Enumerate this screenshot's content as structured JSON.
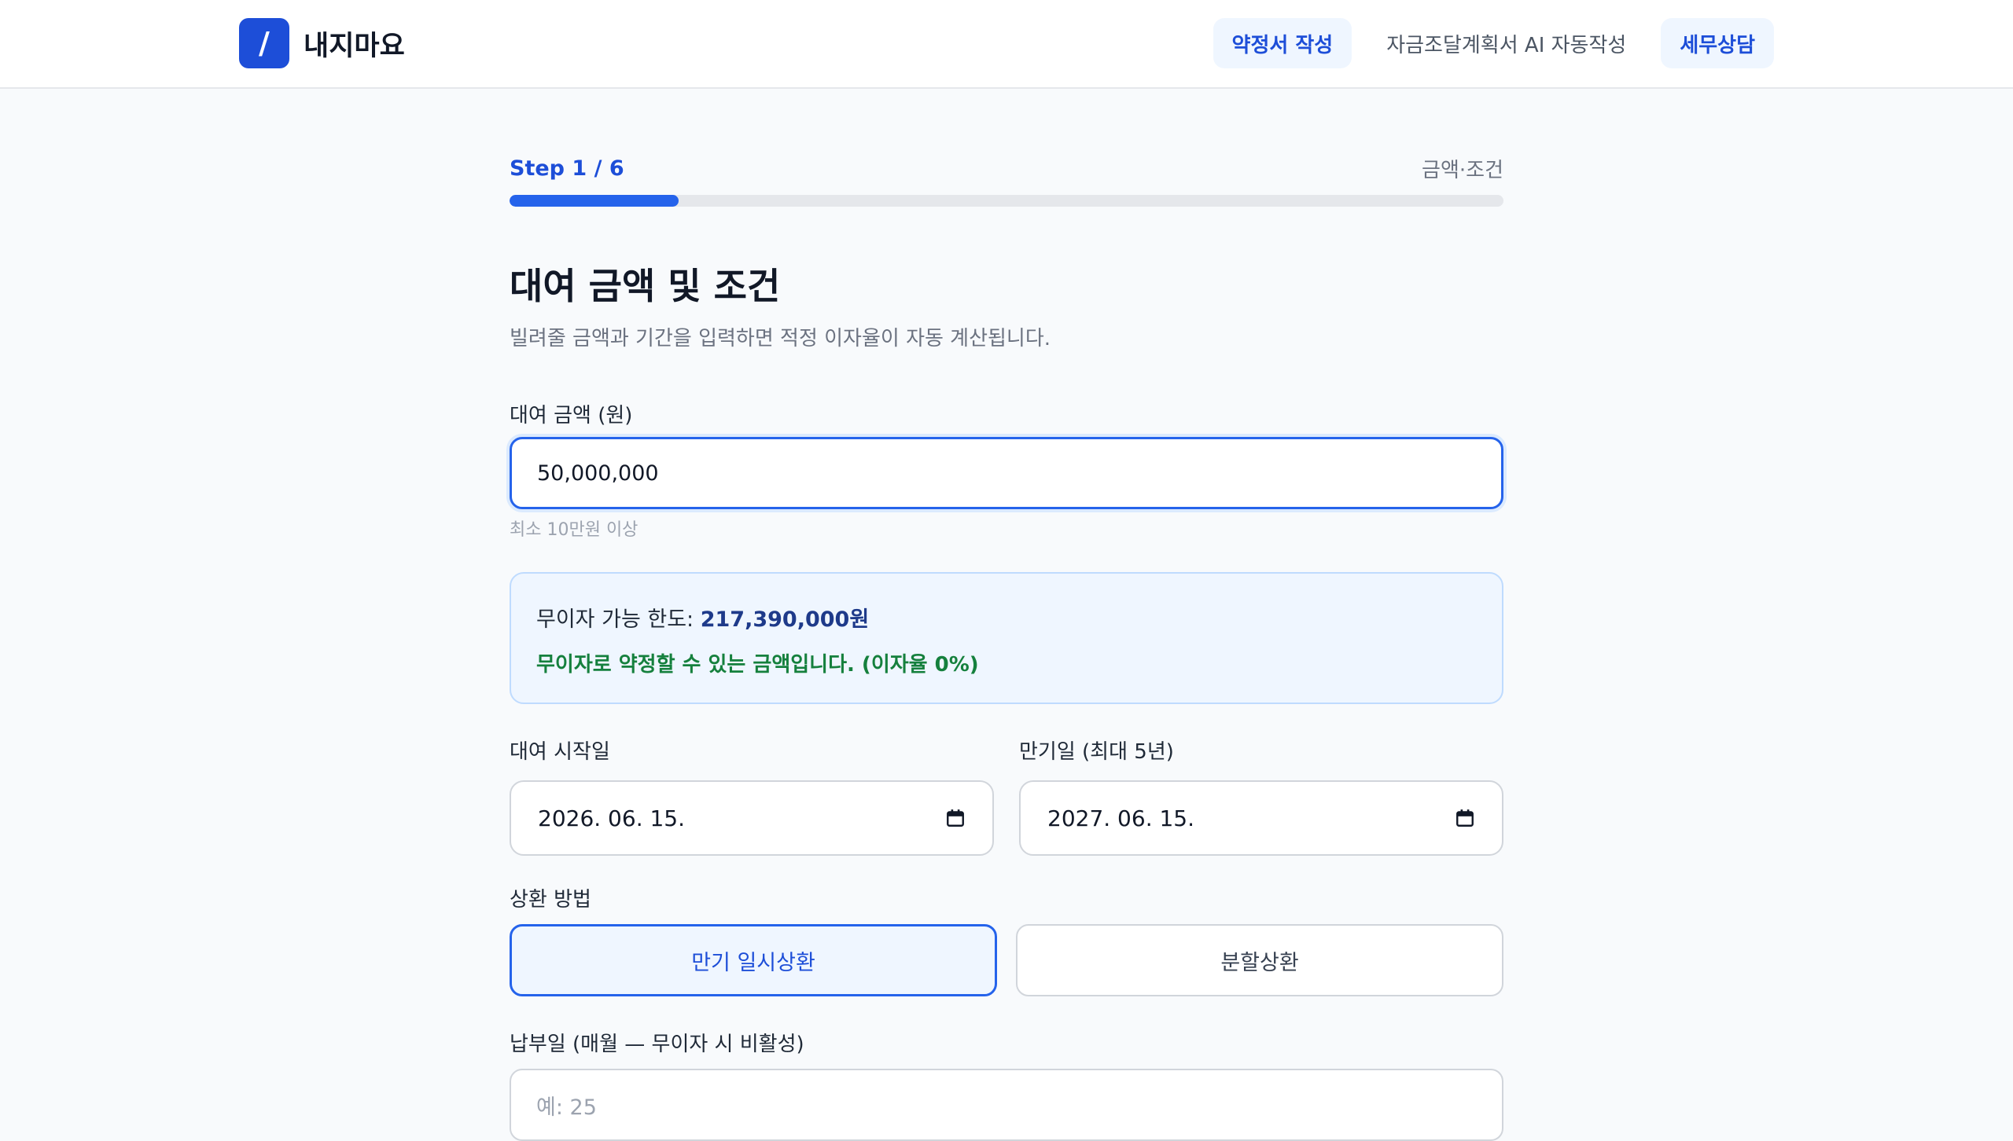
{
  "header": {
    "logo_glyph": "/",
    "brand_name": "내지마요",
    "nav": [
      {
        "label": "약정서 작성",
        "active": true
      },
      {
        "label": "자금조달계획서 AI 자동작성",
        "active": false
      },
      {
        "label": "세무상담",
        "active": true
      }
    ]
  },
  "progress": {
    "step_label": "Step 1 / 6",
    "step_name": "금액·조건",
    "current": 1,
    "total": 6,
    "fill_fraction": 0.17
  },
  "page": {
    "title": "대여 금액 및 조건",
    "description": "빌려줄 금액과 기간을 입력하면 적정 이자율이 자동 계산됩니다."
  },
  "amount": {
    "label": "대여 금액 (원)",
    "value": "50,000,000",
    "hint": "최소 10만원 이상"
  },
  "info": {
    "limit_prefix": "무이자 가능 한도: ",
    "limit_value": "217,390,000원",
    "status": "무이자로 약정할 수 있는 금액입니다. (이자율 0%)"
  },
  "dates": {
    "start_label": "대여 시작일",
    "start_value": "2026. 06. 15.",
    "end_label": "만기일 (최대 5년)",
    "end_value": "2027. 06. 15."
  },
  "repayment": {
    "label": "상환 방법",
    "options": [
      {
        "label": "만기 일시상환",
        "selected": true
      },
      {
        "label": "분할상환",
        "selected": false
      }
    ]
  },
  "payday": {
    "label": "납부일 (매월 — 무이자 시 비활성)",
    "placeholder": "예: 25"
  },
  "colors": {
    "accent": "#2563eb",
    "brand": "#1d4ed8",
    "success": "#15803d",
    "info_bg": "#eff6ff"
  },
  "icons": [
    "calendar-icon"
  ]
}
